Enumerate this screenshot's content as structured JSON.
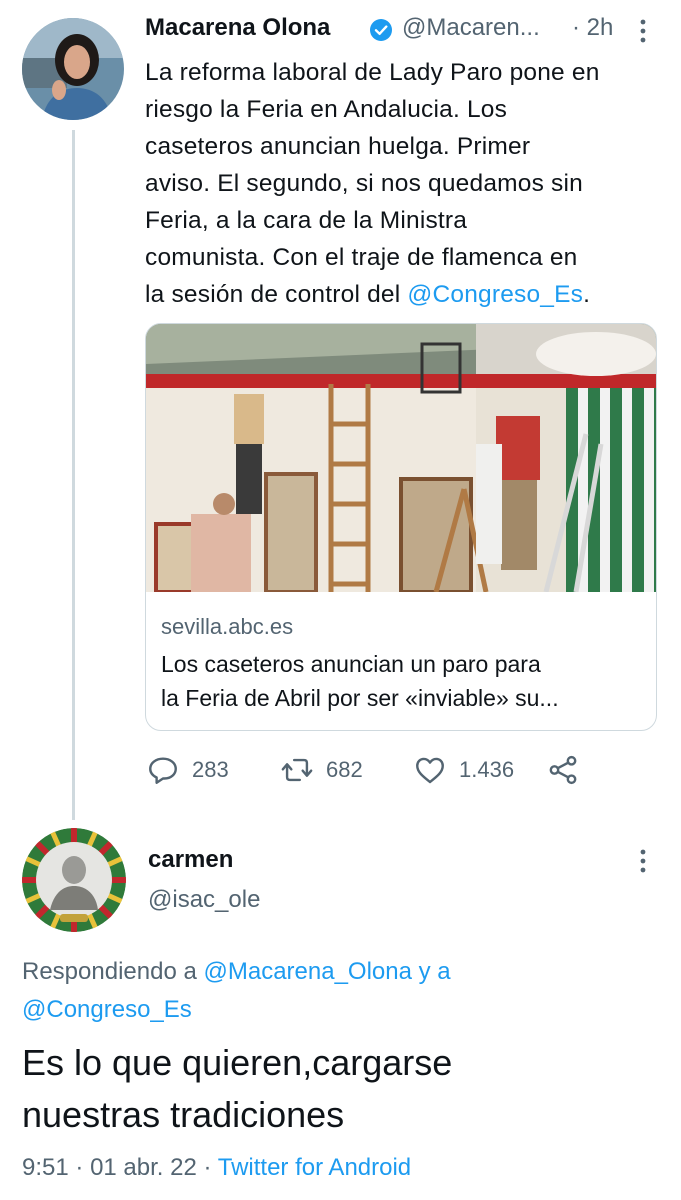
{
  "tweet": {
    "author_name": "Macarena Olona",
    "author_handle": "@Macaren...",
    "time": "· 2h",
    "text_lines": [
      "La reforma laboral de Lady Paro pone en",
      "riesgo la Feria en Andalucia. Los",
      "caseteros anuncian huelga. Primer",
      "aviso. El segundo, si nos quedamos sin",
      "Feria, a la cara de la Ministra",
      "comunista. Con el traje de flamenca en"
    ],
    "last_line_prefix": "la sesión de control del ",
    "last_line_mention": "@Congreso_Es",
    "last_line_suffix": ".",
    "card": {
      "domain": "sevilla.abc.es",
      "title_line1": "Los caseteros anuncian un paro para",
      "title_line2": "la Feria de Abril por ser «inviable» su..."
    },
    "actions": {
      "replies": "283",
      "retweets": "682",
      "likes": "1.436"
    }
  },
  "reply": {
    "author_name": "carmen",
    "author_handle": "@isac_ole",
    "replying_prefix": "Respondiendo a ",
    "replying_mention1": "@Macarena_Olona",
    "replying_conj": " y a",
    "replying_mention2": "@Congreso_Es",
    "text_line1": "Es lo que quieren,cargarse",
    "text_line2": "nuestras tradiciones",
    "time": "9:51",
    "date": "01 abr. 22",
    "source": "Twitter for Android"
  },
  "colors": {
    "accent": "#1d9bf0",
    "secondary_text": "#536471",
    "thread_line": "#cfd9de"
  },
  "icons": [
    "verified-badge-icon",
    "more-options-icon",
    "reply-icon",
    "retweet-icon",
    "like-icon",
    "share-icon"
  ]
}
